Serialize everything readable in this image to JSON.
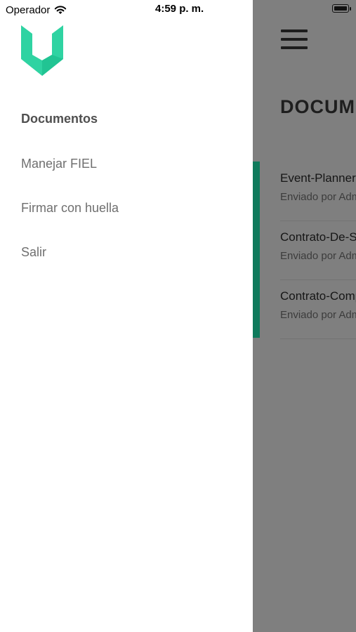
{
  "status_bar": {
    "carrier": "Operador",
    "time": "4:59 p. m."
  },
  "drawer": {
    "menu_items": [
      {
        "label": "Documentos",
        "active": true
      },
      {
        "label": "Manejar FIEL",
        "active": false
      },
      {
        "label": "Firmar con huella",
        "active": false
      },
      {
        "label": "Salir",
        "active": false
      }
    ]
  },
  "background": {
    "title": "DOCUMENTOS",
    "documents": [
      {
        "title": "Event-Planner",
        "subtitle": "Enviado por Admin"
      },
      {
        "title": "Contrato-De-Servicio",
        "subtitle": "Enviado por Admin"
      },
      {
        "title": "Contrato-Compraventa",
        "subtitle": "Enviado por Admin"
      }
    ]
  },
  "colors": {
    "brand": "#2fd3a2",
    "brand_dark": "#21c493",
    "accent_bar": "#0f7a5c",
    "overlay": "#7f7f7f"
  }
}
